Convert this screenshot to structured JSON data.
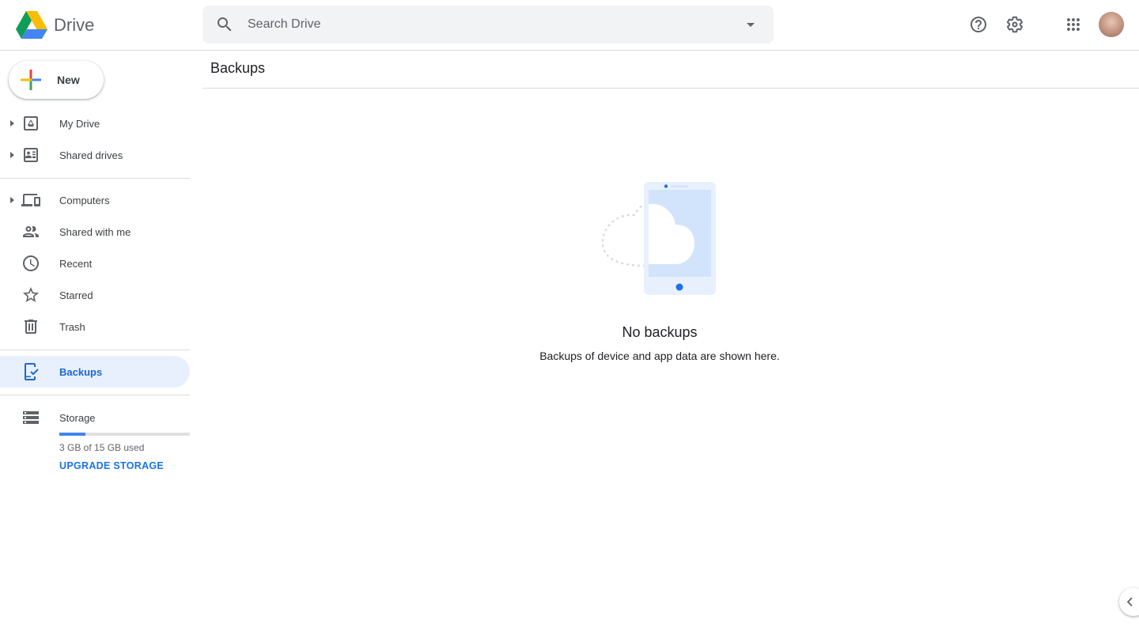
{
  "app": {
    "name": "Drive"
  },
  "search": {
    "placeholder": "Search Drive"
  },
  "header": {
    "help_icon": "help-circle-icon",
    "settings_icon": "gear-icon",
    "apps_icon": "apps-grid-icon"
  },
  "sidebar": {
    "new_label": "New",
    "items": [
      {
        "label": "My Drive",
        "icon": "my-drive-icon",
        "expandable": true
      },
      {
        "label": "Shared drives",
        "icon": "shared-drives-icon",
        "expandable": true
      },
      {
        "label": "Computers",
        "icon": "computers-icon",
        "expandable": true
      },
      {
        "label": "Shared with me",
        "icon": "people-icon",
        "expandable": false
      },
      {
        "label": "Recent",
        "icon": "clock-icon",
        "expandable": false
      },
      {
        "label": "Starred",
        "icon": "star-icon",
        "expandable": false
      },
      {
        "label": "Trash",
        "icon": "trash-icon",
        "expandable": false
      },
      {
        "label": "Backups",
        "icon": "backups-icon",
        "expandable": false,
        "active": true
      }
    ],
    "storage": {
      "label": "Storage",
      "used_text": "3 GB of 15 GB used",
      "used_fraction": 0.2,
      "upgrade_label": "UPGRADE STORAGE"
    }
  },
  "main": {
    "title": "Backups",
    "empty_title": "No backups",
    "empty_subtitle": "Backups of device and app data are shown here."
  },
  "colors": {
    "accent": "#1a73e8",
    "active_bg": "#e8f0fe",
    "active_text": "#1967d2",
    "storage_fill": "#4285f4"
  }
}
